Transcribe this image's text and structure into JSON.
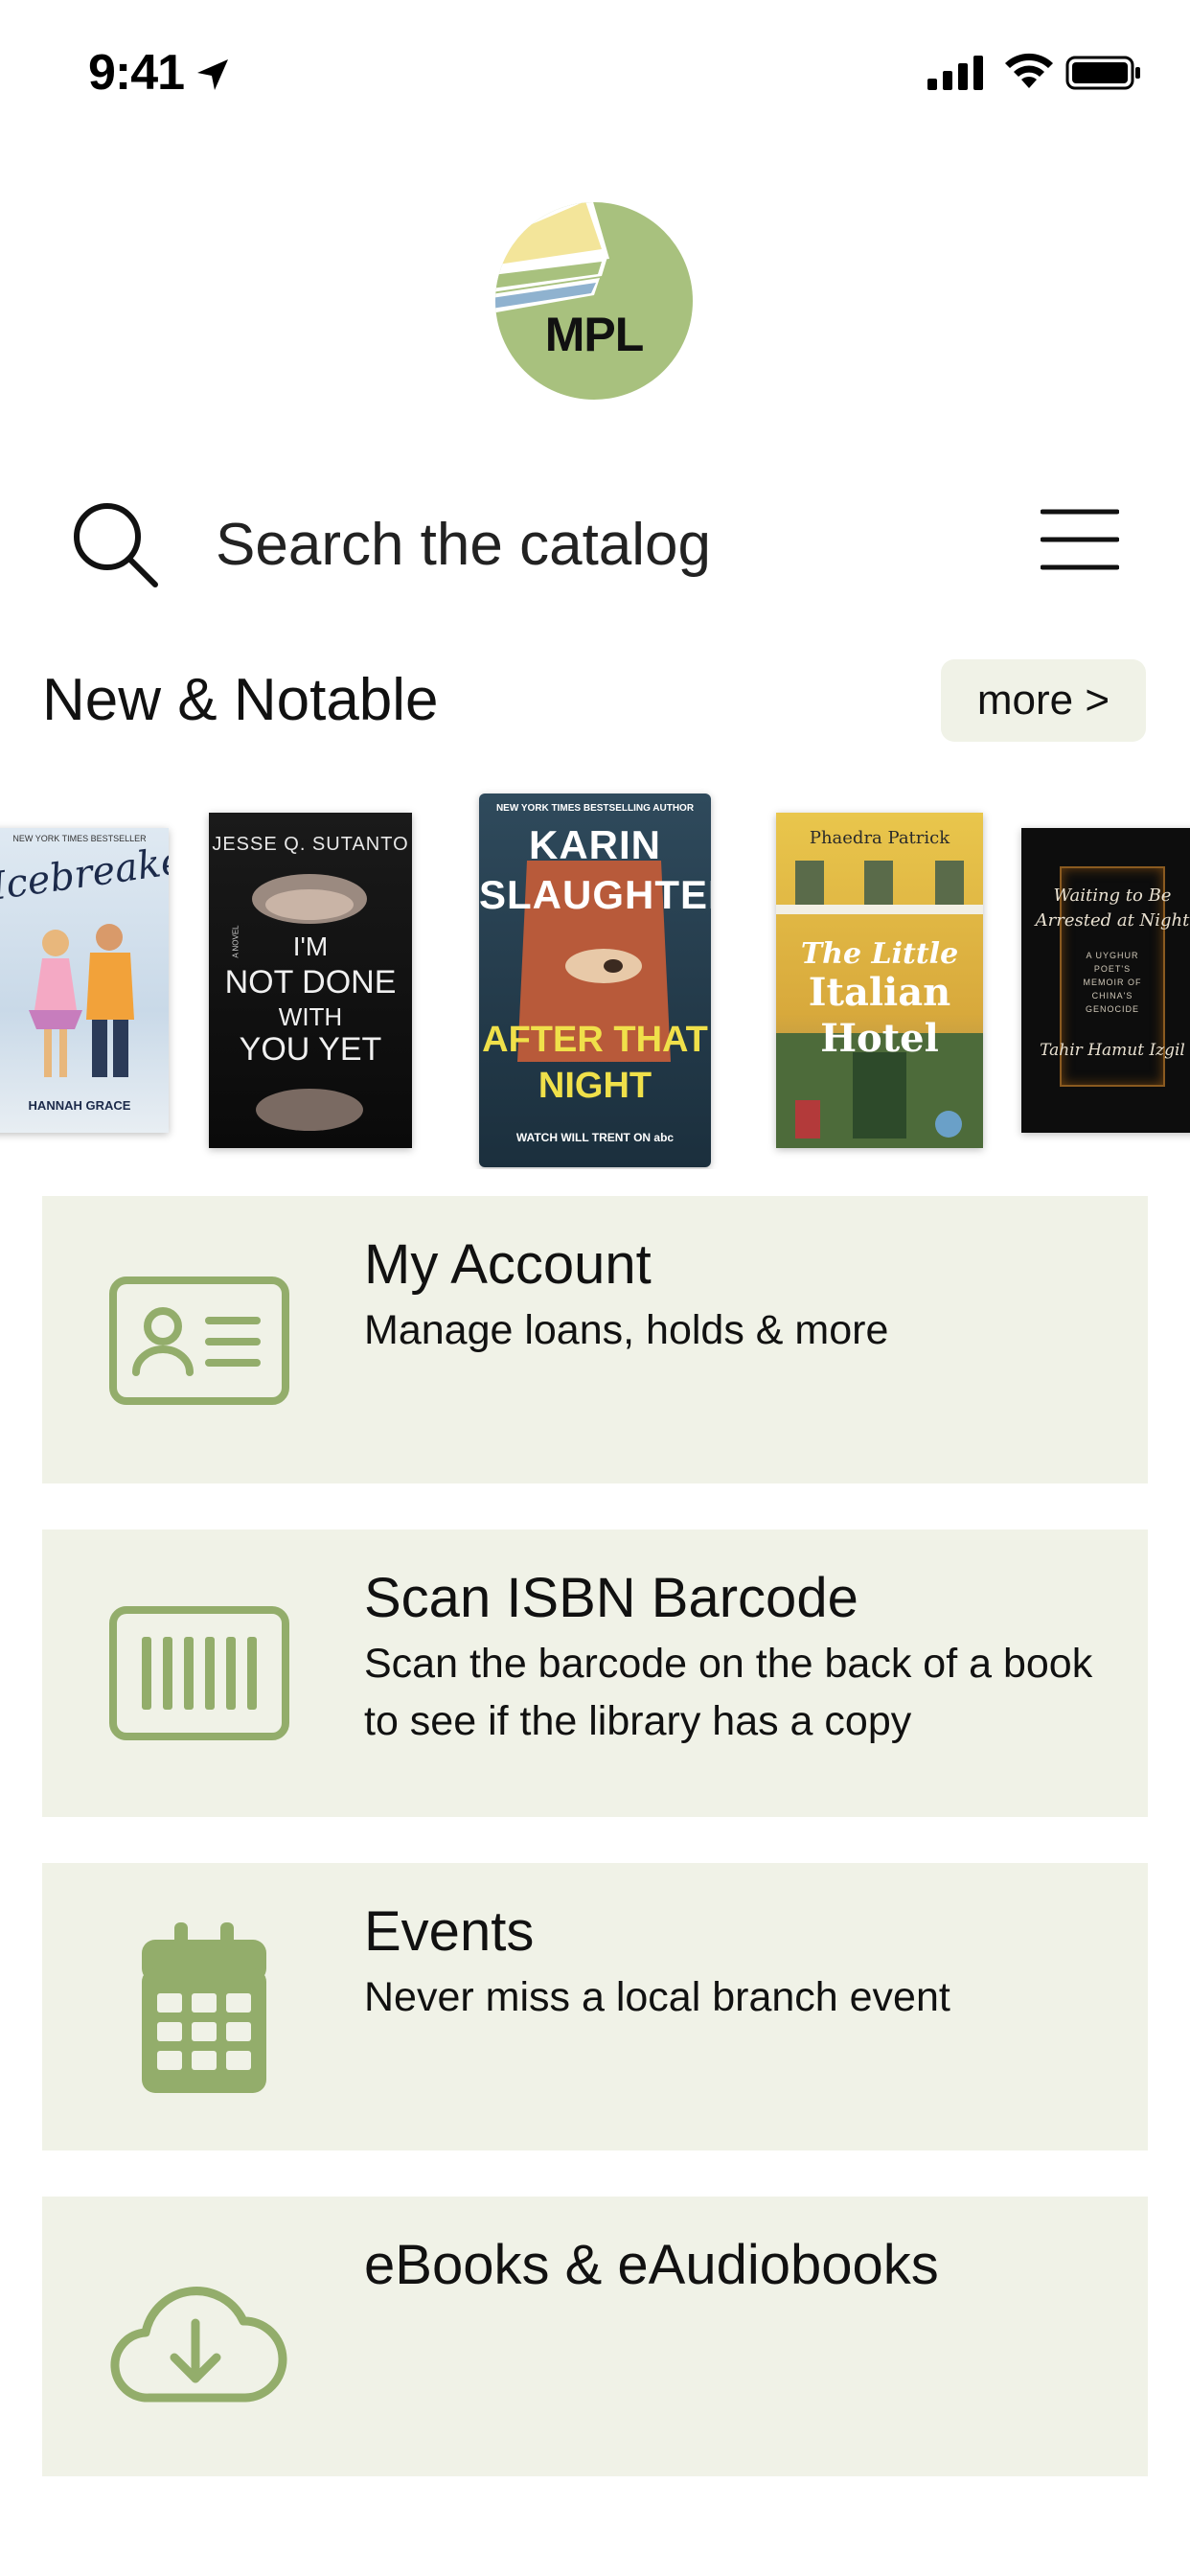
{
  "status_bar": {
    "time": "9:41",
    "icons": [
      "location-arrow-icon",
      "cellular-signal-icon",
      "wifi-icon",
      "battery-icon"
    ]
  },
  "logo": {
    "text": "MPL",
    "colors": {
      "circle": "#a8c17e",
      "stripe_yellow": "#f3e59a",
      "stripe_green": "#a8c17e",
      "stripe_blue": "#8fb2cf"
    }
  },
  "search": {
    "placeholder": "Search the catalog"
  },
  "new_notable": {
    "title": "New & Notable",
    "more_label": "more >",
    "books": [
      {
        "lines": [
          "NEW YORK TIMES BESTSELLER",
          "Icebreaker",
          "HANNAH GRACE"
        ]
      },
      {
        "lines": [
          "JESSE Q. SUTANTO",
          "A NOVEL",
          "I'M",
          "NOT DONE",
          "WITH",
          "YOU YET"
        ]
      },
      {
        "lines": [
          "NEW YORK TIMES BESTSELLING AUTHOR",
          "KARIN",
          "SLAUGHTER",
          "AFTER THAT",
          "NIGHT",
          "WATCH WILL TRENT ON abc"
        ]
      },
      {
        "lines": [
          "Phaedra Patrick",
          "The Little",
          "Italian",
          "Hotel"
        ]
      },
      {
        "lines": [
          "Waiting to Be",
          "Arrested at Night",
          "A UYGHUR",
          "POET'S",
          "MEMOIR OF",
          "CHINA'S",
          "GENOCIDE",
          "Tahir Hamut Izgil"
        ]
      }
    ]
  },
  "cards": [
    {
      "title": "My Account",
      "description": "Manage loans, holds & more",
      "icon": "id-card-icon"
    },
    {
      "title": "Scan ISBN Barcode",
      "description": "Scan the barcode on the back of a book to see if the library has a copy",
      "icon": "barcode-icon"
    },
    {
      "title": "Events",
      "description": "Never miss a local branch event",
      "icon": "calendar-icon"
    },
    {
      "title": "eBooks & eAudiobooks",
      "description": "",
      "icon": "cloud-download-icon"
    }
  ],
  "colors": {
    "accent": "#93ad6b",
    "card_bg": "#f0f2e7"
  }
}
